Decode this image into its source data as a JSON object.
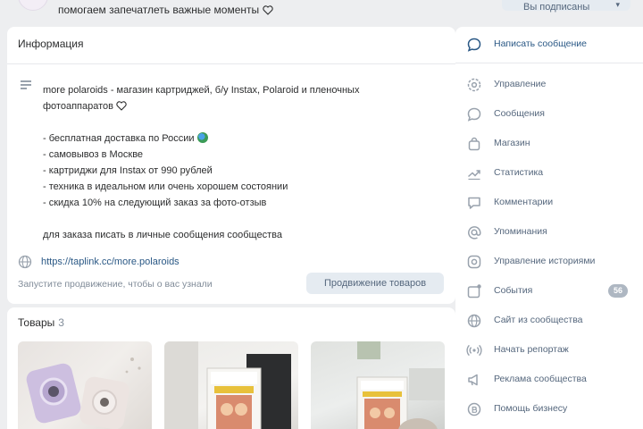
{
  "header": {
    "status": "помогаем запечатлеть важные моменты",
    "subscribe_label": "Вы подписаны"
  },
  "info": {
    "title": "Информация",
    "description": [
      "more polaroids - магазин картриджей, б/у Instax, Polaroid и пленочных",
      "фотоаппаратов",
      "",
      "- бесплатная доставка по России",
      "- самовывоз в Москве",
      "- картриджи для Instax от 990 рублей",
      "- техника в идеальном или очень хорошем состоянии",
      "- скидка 10% на следующий заказ за фото-отзыв",
      "",
      "для заказа писать в личные сообщения сообщества"
    ],
    "link": "https://taplink.cc/more.polaroids",
    "promo_note": "Запустите продвижение, чтобы о вас узнали",
    "promo_button": "Продвижение товаров"
  },
  "products": {
    "title": "Товары",
    "count": "3"
  },
  "sidebar": {
    "items": [
      {
        "label": "Написать сообщение",
        "icon": "message-bubble-icon"
      },
      {
        "label": "Управление",
        "icon": "gear-icon"
      },
      {
        "label": "Сообщения",
        "icon": "chat-icon"
      },
      {
        "label": "Магазин",
        "icon": "shopping-bag-icon"
      },
      {
        "label": "Статистика",
        "icon": "trend-chart-icon"
      },
      {
        "label": "Комментарии",
        "icon": "comment-icon"
      },
      {
        "label": "Упоминания",
        "icon": "at-sign-icon"
      },
      {
        "label": "Управление историями",
        "icon": "stories-icon"
      },
      {
        "label": "События",
        "icon": "event-icon",
        "badge": "56"
      },
      {
        "label": "Сайт из сообщества",
        "icon": "globe-icon"
      },
      {
        "label": "Начать репортаж",
        "icon": "broadcast-icon"
      },
      {
        "label": "Реклама сообщества",
        "icon": "megaphone-icon"
      },
      {
        "label": "Помощь бизнесу",
        "icon": "business-help-icon"
      }
    ]
  },
  "colors": {
    "accent": "#2a5885",
    "sidebar_text": "#55677d",
    "muted": "#818c99",
    "background": "#edeef0"
  }
}
